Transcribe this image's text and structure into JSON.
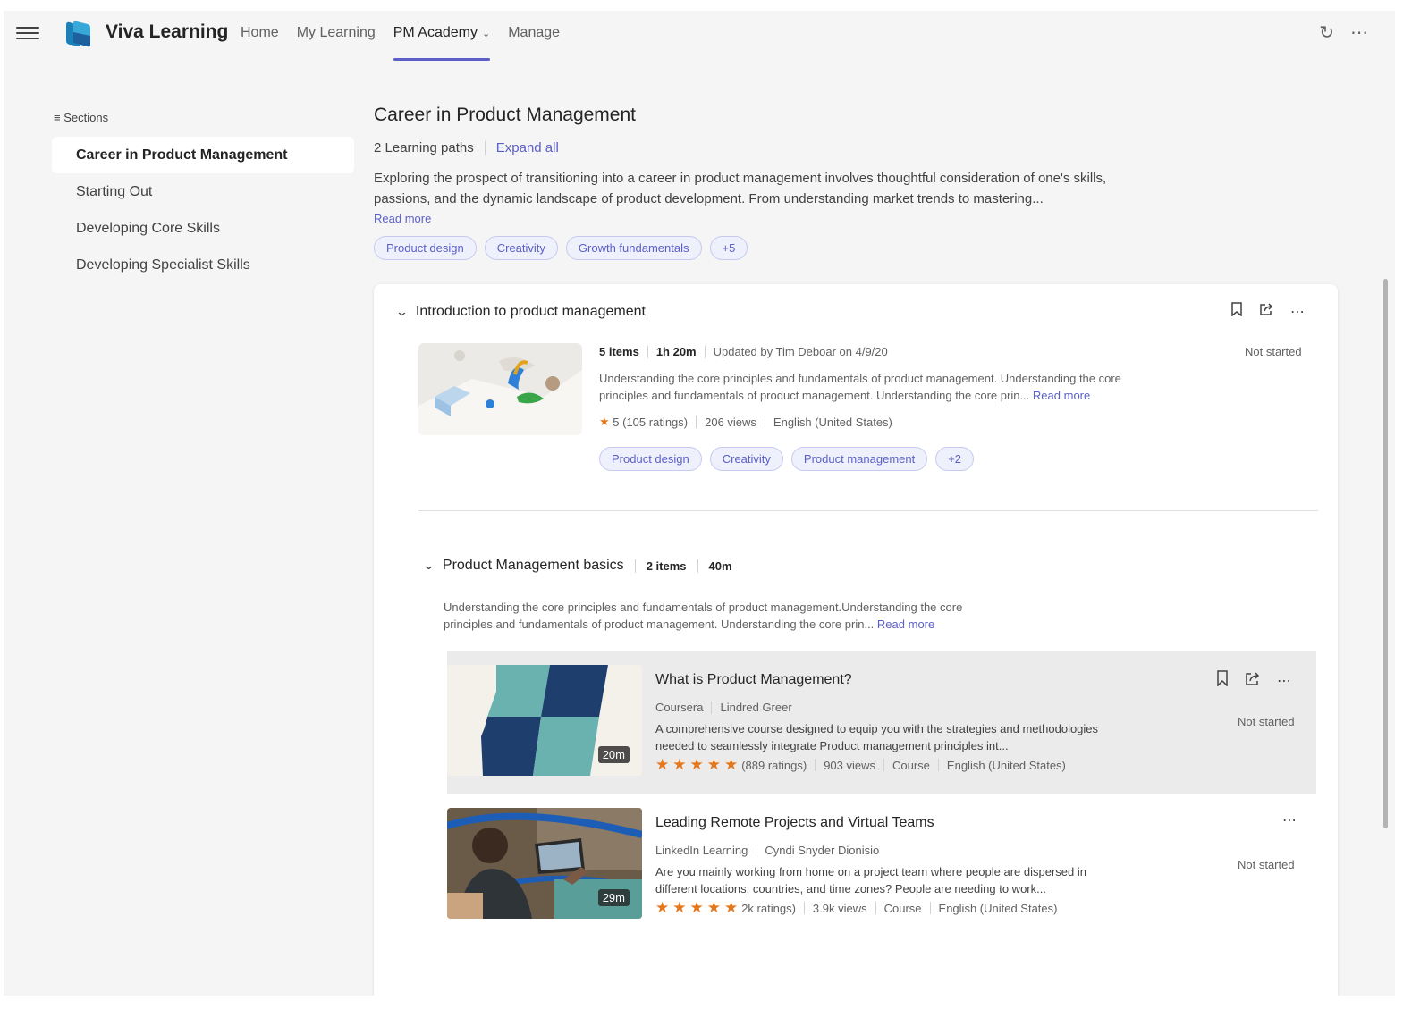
{
  "app": {
    "title": "Viva Learning"
  },
  "nav": {
    "items": [
      "Home",
      "My Learning",
      "PM Academy",
      "Manage"
    ],
    "active": "PM Academy"
  },
  "sidebar": {
    "heading": "Sections",
    "items": [
      "Career in Product Management",
      "Starting Out",
      "Developing Core Skills",
      "Developing Specialist Skills"
    ]
  },
  "page": {
    "title": "Career in Product Management",
    "paths_count": "2 Learning paths",
    "expand_all": "Expand all",
    "description": "Exploring the prospect of transitioning into a career in product management involves thoughtful consideration of one's skills, passions, and the dynamic landscape of product development. From understanding market trends to mastering...",
    "read_more": "Read more",
    "tags": [
      "Product design",
      "Creativity",
      "Growth fundamentals",
      "+5"
    ]
  },
  "learning_path_1": {
    "title": "Introduction to product management",
    "items": "5 items",
    "duration": "1h 20m",
    "updated": "Updated by Tim Deboar on 4/9/20",
    "description": "Understanding the core principles and fundamentals of product management. Understanding the core principles and fundamentals of product management. Understanding the core prin...",
    "read_more": "Read more",
    "rating": "5 (105 ratings)",
    "views": "206 views",
    "language": "English (United States)",
    "status": "Not started",
    "tags": [
      "Product design",
      "Creativity",
      "Product management",
      "+2"
    ]
  },
  "learning_path_2": {
    "title": "Product Management basics",
    "items": "2 items",
    "duration": "40m",
    "description": "Understanding the core principles and fundamentals of product management.Understanding the core principles and fundamentals of product management. Understanding the core prin...",
    "read_more": "Read more"
  },
  "courses": [
    {
      "title": "What is Product Management?",
      "provider": "Coursera",
      "author": "Lindred Greer",
      "description": "A comprehensive course designed to equip you with the strategies and methodologies needed to seamlessly integrate Product management principles int...",
      "stars": "★★★★★",
      "ratings": "(889 ratings)",
      "views": "903 views",
      "type": "Course",
      "language": "English (United States)",
      "status": "Not started",
      "duration": "20m"
    },
    {
      "title": "Leading Remote Projects and Virtual Teams",
      "provider": "LinkedIn Learning",
      "author": "Cyndi Snyder Dionisio",
      "description": "Are you mainly working from home on a project team where people are dispersed in different locations, countries, and time zones? People are needing to work...",
      "stars": "★★★★★",
      "ratings": "2k ratings)",
      "views": "3.9k views",
      "type": "Course",
      "language": "English (United States)",
      "status": "Not started",
      "duration": "29m"
    }
  ],
  "icons": {
    "menu": "hamburger-icon",
    "refresh": "refresh-icon",
    "more": "more-icon",
    "bookmark": "bookmark-icon",
    "share": "share-icon",
    "star": "star-icon",
    "chevron": "chevron-down-icon"
  },
  "colors": {
    "accent": "#5b5fc7",
    "star": "#e3781c",
    "background": "#f5f5f5"
  }
}
